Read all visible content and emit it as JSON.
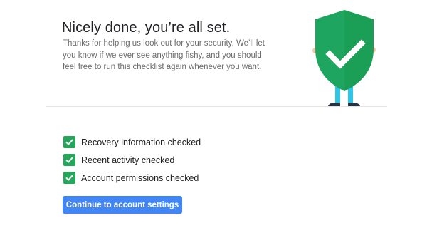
{
  "header": {
    "title": "Nicely done, you’re all set.",
    "description": "Thanks for helping us look out for your security. We’ll let you know if we ever see anything fishy, and you should feel free to run this checklist again whenever you want."
  },
  "checklist": {
    "items": [
      {
        "label": "Recovery information checked",
        "icon": "checkbox-checked-icon"
      },
      {
        "label": "Recent activity checked",
        "icon": "checkbox-checked-icon"
      },
      {
        "label": "Account permissions checked",
        "icon": "checkbox-checked-icon"
      }
    ]
  },
  "actions": {
    "continue_label": "Continue to account settings"
  },
  "illustration": {
    "icon": "security-shield-figure-icon"
  },
  "colors": {
    "accent_blue": "#4285f4",
    "check_green": "#26a65b",
    "shield_green": "#1ea660",
    "shield_dark": "#16924f",
    "legs_cyan": "#2fc6e6",
    "shoes_dark": "#233544"
  }
}
